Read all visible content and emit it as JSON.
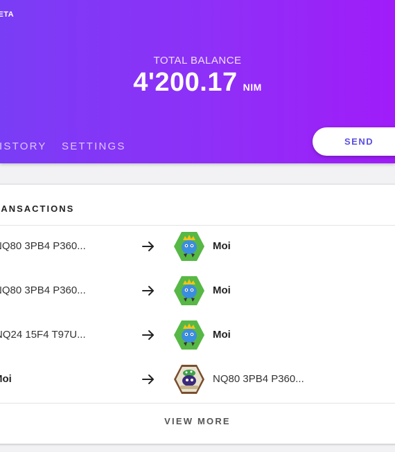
{
  "header": {
    "beta_label": "BETA",
    "balance_label": "TOTAL BALANCE",
    "balance_value": "4'200.17",
    "balance_unit": "NIM",
    "gradient_start": "#7a3df6",
    "gradient_end": "#a01cf9",
    "tabs": [
      {
        "label": "HISTORY"
      },
      {
        "label": "SETTINGS"
      }
    ],
    "send_label": "SEND",
    "send_color": "#5c4fe0"
  },
  "transactions": {
    "title": "TRANSACTIONS",
    "rows": [
      {
        "sender": "NQ80 3PB4 P360...",
        "sender_bold": false,
        "recipient": "Moi",
        "recipient_bold": true,
        "avatar": "green-hexagon-crowned-blue-creature-avatar"
      },
      {
        "sender": "NQ80 3PB4 P360...",
        "sender_bold": false,
        "recipient": "Moi",
        "recipient_bold": true,
        "avatar": "green-hexagon-crowned-blue-creature-avatar"
      },
      {
        "sender": "NQ24 15F4 T97U...",
        "sender_bold": false,
        "recipient": "Moi",
        "recipient_bold": true,
        "avatar": "green-hexagon-crowned-blue-creature-avatar"
      },
      {
        "sender": "Moi",
        "sender_bold": true,
        "recipient": "NQ80 3PB4 P360...",
        "recipient_bold": false,
        "avatar": "brown-hexagon-purple-creature-avatar"
      }
    ],
    "view_more_label": "VIEW MORE",
    "arrow_icon": "arrow-right-icon"
  }
}
